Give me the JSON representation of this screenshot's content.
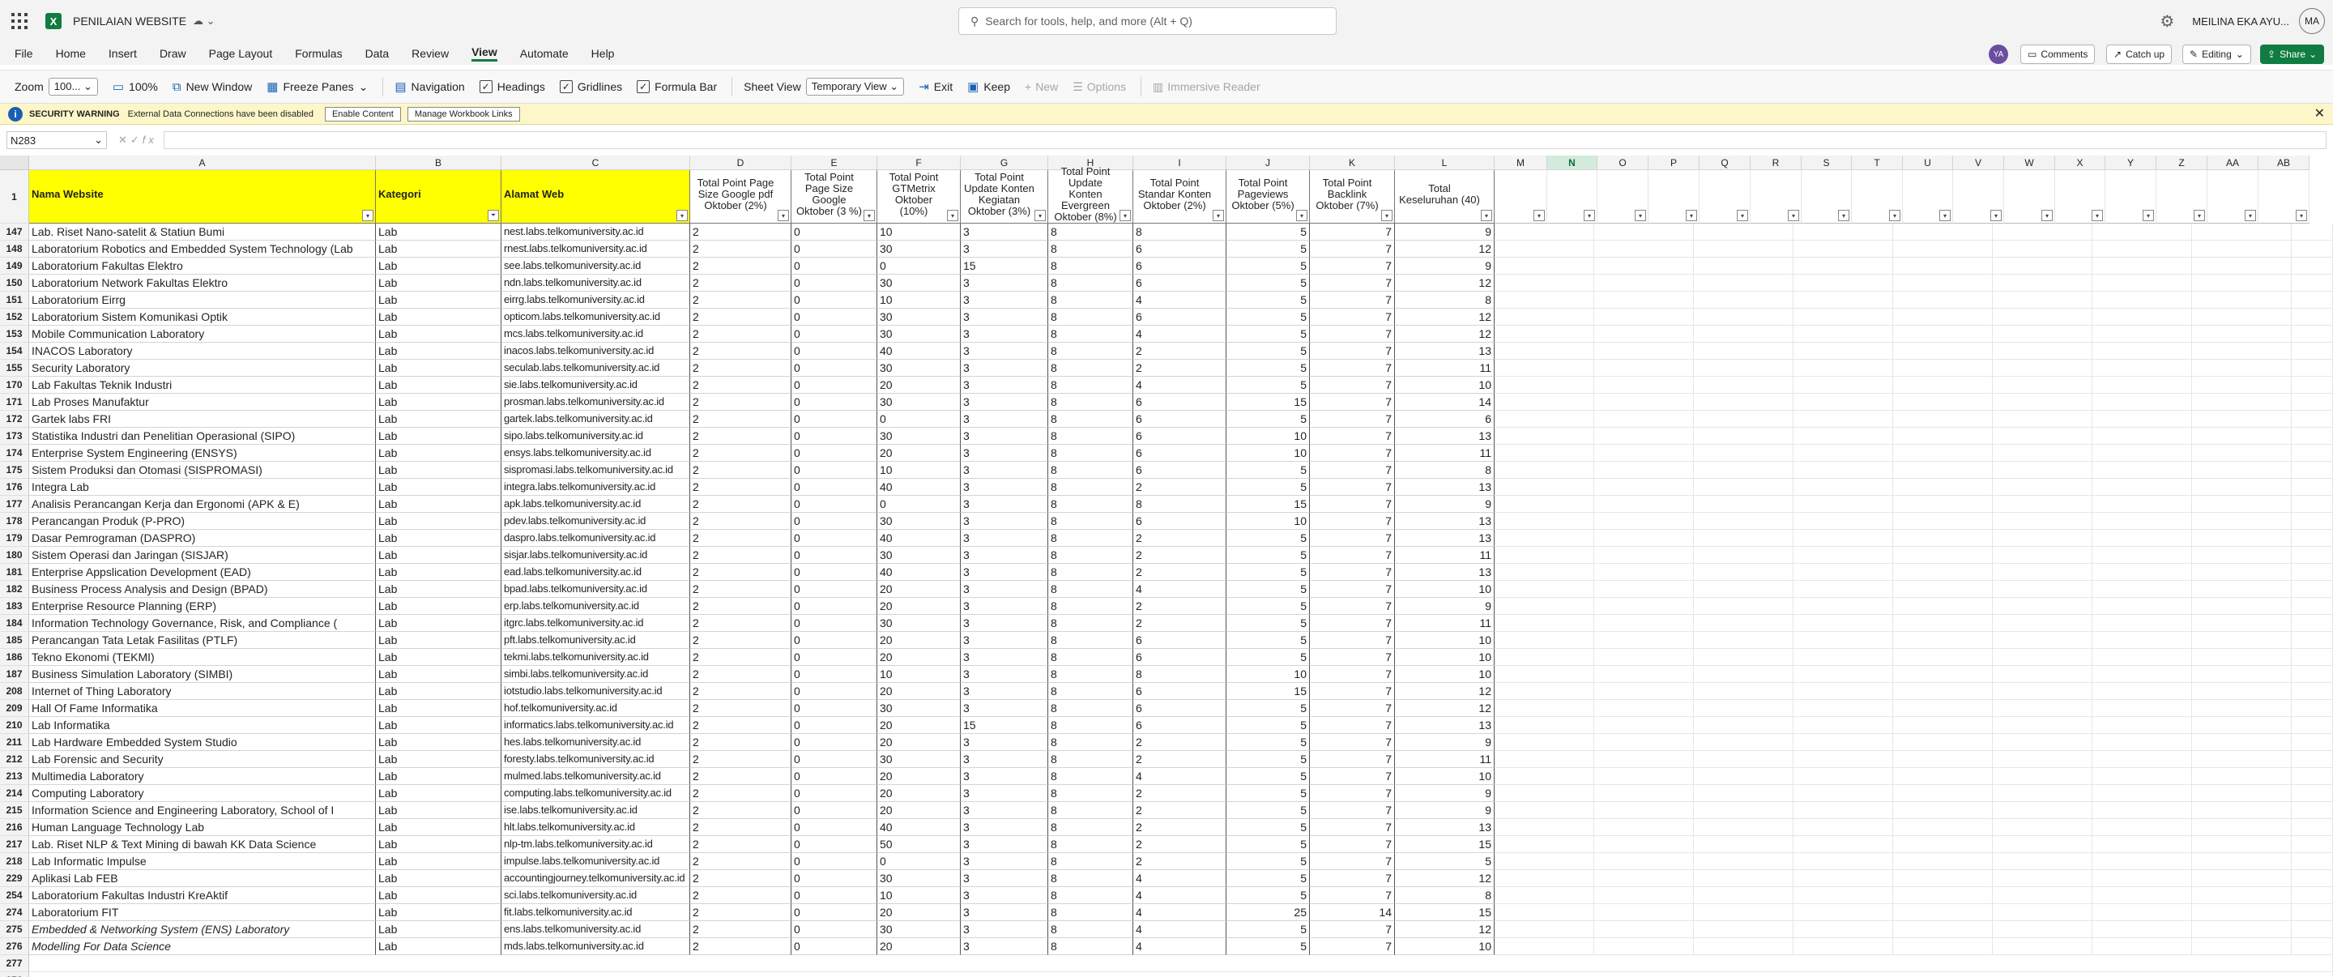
{
  "app": {
    "doc_title": "PENILAIAN WEBSITE",
    "search_placeholder": "Search for tools, help, and more (Alt + Q)",
    "user_name": "MEILINA EKA AYU...",
    "user_initials": "MA",
    "presence_initials": "YA"
  },
  "menu": {
    "items": [
      "File",
      "Home",
      "Insert",
      "Draw",
      "Page Layout",
      "Formulas",
      "Data",
      "Review",
      "View",
      "Automate",
      "Help"
    ],
    "active": "View",
    "comments": "Comments",
    "catchup": "Catch up",
    "editing": "Editing",
    "share": "Share"
  },
  "ribbon": {
    "zoom_label": "Zoom",
    "zoom_value": "100...",
    "zoom_100": "100%",
    "new_window": "New Window",
    "freeze": "Freeze Panes",
    "navigation": "Navigation",
    "headings": "Headings",
    "gridlines": "Gridlines",
    "formula_bar": "Formula Bar",
    "sheet_view": "Sheet View",
    "temp_view": "Temporary View",
    "exit": "Exit",
    "keep": "Keep",
    "new": "New",
    "options": "Options",
    "immersive": "Immersive Reader"
  },
  "security": {
    "title": "SECURITY WARNING",
    "message": "External Data Connections have been disabled",
    "enable": "Enable Content",
    "manage": "Manage Workbook Links"
  },
  "formula": {
    "name_box": "N283",
    "fx": "fx",
    "value": ""
  },
  "sheet": {
    "columns": [
      "A",
      "B",
      "C",
      "D",
      "E",
      "F",
      "G",
      "H",
      "I",
      "J",
      "K",
      "L",
      "M",
      "N",
      "O",
      "P",
      "Q",
      "R",
      "S",
      "T",
      "U",
      "V",
      "W",
      "X",
      "Y",
      "Z",
      "AA",
      "AB"
    ],
    "selected_column": "N",
    "header_row_number": "1",
    "headers": [
      "Nama Website",
      "Kategori",
      "Alamat Web",
      "Total Point Page Size Google pdf Oktober (2%)",
      "Total Point Page Size Google Oktober (3 %)",
      "Total Point GTMetrix Oktober (10%)",
      "Total Point Update Konten Kegiatan Oktober (3%)",
      "Total Point Update Konten Evergreen Oktober (8%)",
      "Total Point Standar Konten Oktober (2%)",
      "Total Point Pageviews Oktober (5%)",
      "Total Point Backlink Oktober (7%)",
      "Total Keseluruhan (40)"
    ],
    "rows": [
      {
        "n": "147",
        "a": "Lab. Riset Nano-satelit & Statiun Bumi",
        "b": "Lab",
        "c": "nest.labs.telkomuniversity.ac.id",
        "d": "2",
        "e": "0",
        "f": "10",
        "g": "3",
        "h": "8",
        "i": "8",
        "j": "5",
        "k": "7",
        "l": "9"
      },
      {
        "n": "148",
        "a": "Laboratorium Robotics and Embedded System Technology (Lab",
        "b": "Lab",
        "c": "rnest.labs.telkomuniversity.ac.id",
        "d": "2",
        "e": "0",
        "f": "30",
        "g": "3",
        "h": "8",
        "i": "6",
        "j": "5",
        "k": "7",
        "l": "12"
      },
      {
        "n": "149",
        "a": "Laboratorium Fakultas Elektro",
        "b": "Lab",
        "c": "see.labs.telkomuniversity.ac.id",
        "d": "2",
        "e": "0",
        "f": "0",
        "g": "15",
        "h": "8",
        "i": "6",
        "j": "5",
        "k": "7",
        "l": "9"
      },
      {
        "n": "150",
        "a": "Laboratorium Network Fakultas Elektro",
        "b": "Lab",
        "c": "ndn.labs.telkomuniversity.ac.id",
        "d": "2",
        "e": "0",
        "f": "30",
        "g": "3",
        "h": "8",
        "i": "6",
        "j": "5",
        "k": "7",
        "l": "12"
      },
      {
        "n": "151",
        "a": "Laboratorium Eirrg",
        "b": "Lab",
        "c": "eirrg.labs.telkomuniversity.ac.id",
        "d": "2",
        "e": "0",
        "f": "10",
        "g": "3",
        "h": "8",
        "i": "4",
        "j": "5",
        "k": "7",
        "l": "8"
      },
      {
        "n": "152",
        "a": "Laboratorium Sistem Komunikasi Optik",
        "b": "Lab",
        "c": "opticom.labs.telkomuniversity.ac.id",
        "d": "2",
        "e": "0",
        "f": "30",
        "g": "3",
        "h": "8",
        "i": "6",
        "j": "5",
        "k": "7",
        "l": "12"
      },
      {
        "n": "153",
        "a": "Mobile Communication Laboratory",
        "b": "Lab",
        "c": "mcs.labs.telkomuniversity.ac.id",
        "d": "2",
        "e": "0",
        "f": "30",
        "g": "3",
        "h": "8",
        "i": "4",
        "j": "5",
        "k": "7",
        "l": "12"
      },
      {
        "n": "154",
        "a": "INACOS Laboratory",
        "b": "Lab",
        "c": "inacos.labs.telkomuniversity.ac.id",
        "d": "2",
        "e": "0",
        "f": "40",
        "g": "3",
        "h": "8",
        "i": "2",
        "j": "5",
        "k": "7",
        "l": "13"
      },
      {
        "n": "155",
        "a": "Security Laboratory",
        "b": "Lab",
        "c": "seculab.labs.telkomuniversity.ac.id",
        "d": "2",
        "e": "0",
        "f": "30",
        "g": "3",
        "h": "8",
        "i": "2",
        "j": "5",
        "k": "7",
        "l": "11"
      },
      {
        "n": "170",
        "a": "Lab Fakultas Teknik Industri",
        "b": "Lab",
        "c": "sie.labs.telkomuniversity.ac.id",
        "d": "2",
        "e": "0",
        "f": "20",
        "g": "3",
        "h": "8",
        "i": "4",
        "j": "5",
        "k": "7",
        "l": "10"
      },
      {
        "n": "171",
        "a": "Lab Proses Manufaktur",
        "b": "Lab",
        "c": "prosman.labs.telkomuniversity.ac.id",
        "d": "2",
        "e": "0",
        "f": "30",
        "g": "3",
        "h": "8",
        "i": "6",
        "j": "15",
        "k": "7",
        "l": "14"
      },
      {
        "n": "172",
        "a": "Gartek labs FRI",
        "b": "Lab",
        "c": "gartek.labs.telkomuniversity.ac.id",
        "d": "2",
        "e": "0",
        "f": "0",
        "g": "3",
        "h": "8",
        "i": "6",
        "j": "5",
        "k": "7",
        "l": "6"
      },
      {
        "n": "173",
        "a": "Statistika Industri dan Penelitian Operasional (SIPO)",
        "b": "Lab",
        "c": "sipo.labs.telkomuniversity.ac.id",
        "d": "2",
        "e": "0",
        "f": "30",
        "g": "3",
        "h": "8",
        "i": "6",
        "j": "10",
        "k": "7",
        "l": "13"
      },
      {
        "n": "174",
        "a": "Enterprise System Engineering (ENSYS)",
        "b": "Lab",
        "c": "ensys.labs.telkomuniversity.ac.id",
        "d": "2",
        "e": "0",
        "f": "20",
        "g": "3",
        "h": "8",
        "i": "6",
        "j": "10",
        "k": "7",
        "l": "11"
      },
      {
        "n": "175",
        "a": "Sistem Produksi dan Otomasi (SISPROMASI)",
        "b": "Lab",
        "c": "sispromasi.labs.telkomuniversity.ac.id",
        "d": "2",
        "e": "0",
        "f": "10",
        "g": "3",
        "h": "8",
        "i": "6",
        "j": "5",
        "k": "7",
        "l": "8"
      },
      {
        "n": "176",
        "a": "Integra Lab",
        "b": "Lab",
        "c": "integra.labs.telkomuniversity.ac.id",
        "d": "2",
        "e": "0",
        "f": "40",
        "g": "3",
        "h": "8",
        "i": "2",
        "j": "5",
        "k": "7",
        "l": "13"
      },
      {
        "n": "177",
        "a": "Analisis Perancangan Kerja dan Ergonomi (APK & E)",
        "b": "Lab",
        "c": "apk.labs.telkomuniversity.ac.id",
        "d": "2",
        "e": "0",
        "f": "0",
        "g": "3",
        "h": "8",
        "i": "8",
        "j": "15",
        "k": "7",
        "l": "9"
      },
      {
        "n": "178",
        "a": "Perancangan Produk (P-PRO)",
        "b": "Lab",
        "c": "pdev.labs.telkomuniversity.ac.id",
        "d": "2",
        "e": "0",
        "f": "30",
        "g": "3",
        "h": "8",
        "i": "6",
        "j": "10",
        "k": "7",
        "l": "13"
      },
      {
        "n": "179",
        "a": "Dasar Pemrograman (DASPRO)",
        "b": "Lab",
        "c": "daspro.labs.telkomuniversity.ac.id",
        "d": "2",
        "e": "0",
        "f": "40",
        "g": "3",
        "h": "8",
        "i": "2",
        "j": "5",
        "k": "7",
        "l": "13"
      },
      {
        "n": "180",
        "a": "Sistem Operasi dan Jaringan (SISJAR)",
        "b": "Lab",
        "c": "sisjar.labs.telkomuniversity.ac.id",
        "d": "2",
        "e": "0",
        "f": "30",
        "g": "3",
        "h": "8",
        "i": "2",
        "j": "5",
        "k": "7",
        "l": "11"
      },
      {
        "n": "181",
        "a": "Enterprise Appslication Development (EAD)",
        "b": "Lab",
        "c": "ead.labs.telkomuniversity.ac.id",
        "d": "2",
        "e": "0",
        "f": "40",
        "g": "3",
        "h": "8",
        "i": "2",
        "j": "5",
        "k": "7",
        "l": "13"
      },
      {
        "n": "182",
        "a": "Business Process Analysis and Design (BPAD)",
        "b": "Lab",
        "c": "bpad.labs.telkomuniversity.ac.id",
        "d": "2",
        "e": "0",
        "f": "20",
        "g": "3",
        "h": "8",
        "i": "4",
        "j": "5",
        "k": "7",
        "l": "10"
      },
      {
        "n": "183",
        "a": "Enterprise Resource Planning (ERP)",
        "b": "Lab",
        "c": "erp.labs.telkomuniversity.ac.id",
        "d": "2",
        "e": "0",
        "f": "20",
        "g": "3",
        "h": "8",
        "i": "2",
        "j": "5",
        "k": "7",
        "l": "9"
      },
      {
        "n": "184",
        "a": "Information Technology Governance, Risk, and Compliance (",
        "b": "Lab",
        "c": "itgrc.labs.telkomuniversity.ac.id",
        "d": "2",
        "e": "0",
        "f": "30",
        "g": "3",
        "h": "8",
        "i": "2",
        "j": "5",
        "k": "7",
        "l": "11"
      },
      {
        "n": "185",
        "a": "Perancangan Tata Letak Fasilitas (PTLF)",
        "b": "Lab",
        "c": "pft.labs.telkomuniversity.ac.id",
        "d": "2",
        "e": "0",
        "f": "20",
        "g": "3",
        "h": "8",
        "i": "6",
        "j": "5",
        "k": "7",
        "l": "10"
      },
      {
        "n": "186",
        "a": "Tekno Ekonomi (TEKMI)",
        "b": "Lab",
        "c": "tekmi.labs.telkomuniversity.ac.id",
        "d": "2",
        "e": "0",
        "f": "20",
        "g": "3",
        "h": "8",
        "i": "6",
        "j": "5",
        "k": "7",
        "l": "10"
      },
      {
        "n": "187",
        "a": "Business Simulation Laboratory (SIMBI)",
        "b": "Lab",
        "c": "simbi.labs.telkomuniversity.ac.id",
        "d": "2",
        "e": "0",
        "f": "10",
        "g": "3",
        "h": "8",
        "i": "8",
        "j": "10",
        "k": "7",
        "l": "10"
      },
      {
        "n": "208",
        "a": "Internet of Thing Laboratory",
        "b": "Lab",
        "c": "iotstudio.labs.telkomuniversity.ac.id",
        "d": "2",
        "e": "0",
        "f": "20",
        "g": "3",
        "h": "8",
        "i": "6",
        "j": "15",
        "k": "7",
        "l": "12"
      },
      {
        "n": "209",
        "a": "Hall Of Fame Informatika",
        "b": "Lab",
        "c": "hof.telkomuniversity.ac.id",
        "d": "2",
        "e": "0",
        "f": "30",
        "g": "3",
        "h": "8",
        "i": "6",
        "j": "5",
        "k": "7",
        "l": "12"
      },
      {
        "n": "210",
        "a": "Lab Informatika",
        "b": "Lab",
        "c": "informatics.labs.telkomuniversity.ac.id",
        "d": "2",
        "e": "0",
        "f": "20",
        "g": "15",
        "h": "8",
        "i": "6",
        "j": "5",
        "k": "7",
        "l": "13"
      },
      {
        "n": "211",
        "a": "Lab Hardware Embedded System Studio",
        "b": "Lab",
        "c": "hes.labs.telkomuniversity.ac.id",
        "d": "2",
        "e": "0",
        "f": "20",
        "g": "3",
        "h": "8",
        "i": "2",
        "j": "5",
        "k": "7",
        "l": "9"
      },
      {
        "n": "212",
        "a": "Lab Forensic and Security",
        "b": "Lab",
        "c": "foresty.labs.telkomuniversity.ac.id",
        "d": "2",
        "e": "0",
        "f": "30",
        "g": "3",
        "h": "8",
        "i": "2",
        "j": "5",
        "k": "7",
        "l": "11"
      },
      {
        "n": "213",
        "a": "Multimedia Laboratory",
        "b": "Lab",
        "c": "mulmed.labs.telkomuniversity.ac.id",
        "d": "2",
        "e": "0",
        "f": "20",
        "g": "3",
        "h": "8",
        "i": "4",
        "j": "5",
        "k": "7",
        "l": "10"
      },
      {
        "n": "214",
        "a": "Computing Laboratory",
        "b": "Lab",
        "c": "computing.labs.telkomuniversity.ac.id",
        "d": "2",
        "e": "0",
        "f": "20",
        "g": "3",
        "h": "8",
        "i": "2",
        "j": "5",
        "k": "7",
        "l": "9"
      },
      {
        "n": "215",
        "a": "Information Science and Engineering Laboratory, School of I",
        "b": "Lab",
        "c": "ise.labs.telkomuniversity.ac.id",
        "d": "2",
        "e": "0",
        "f": "20",
        "g": "3",
        "h": "8",
        "i": "2",
        "j": "5",
        "k": "7",
        "l": "9"
      },
      {
        "n": "216",
        "a": "Human Language Technology Lab",
        "b": "Lab",
        "c": "hlt.labs.telkomuniversity.ac.id",
        "d": "2",
        "e": "0",
        "f": "40",
        "g": "3",
        "h": "8",
        "i": "2",
        "j": "5",
        "k": "7",
        "l": "13"
      },
      {
        "n": "217",
        "a": "Lab. Riset NLP & Text Mining di bawah KK Data Science",
        "b": "Lab",
        "c": "nlp-tm.labs.telkomuniversity.ac.id",
        "d": "2",
        "e": "0",
        "f": "50",
        "g": "3",
        "h": "8",
        "i": "2",
        "j": "5",
        "k": "7",
        "l": "15"
      },
      {
        "n": "218",
        "a": "Lab Informatic Impulse",
        "b": "Lab",
        "c": "impulse.labs.telkomuniversity.ac.id",
        "d": "2",
        "e": "0",
        "f": "0",
        "g": "3",
        "h": "8",
        "i": "2",
        "j": "5",
        "k": "7",
        "l": "5"
      },
      {
        "n": "229",
        "a": "Aplikasi Lab FEB",
        "b": "Lab",
        "c": "accountingjourney.telkomuniversity.ac.id",
        "d": "2",
        "e": "0",
        "f": "30",
        "g": "3",
        "h": "8",
        "i": "4",
        "j": "5",
        "k": "7",
        "l": "12"
      },
      {
        "n": "254",
        "a": "Laboratorium Fakultas Industri KreAktif",
        "b": "Lab",
        "c": "sci.labs.telkomuniversity.ac.id",
        "d": "2",
        "e": "0",
        "f": "10",
        "g": "3",
        "h": "8",
        "i": "4",
        "j": "5",
        "k": "7",
        "l": "8"
      },
      {
        "n": "274",
        "a": "Laboratorium FIT",
        "b": "Lab",
        "c": "fit.labs.telkomuniversity.ac.id",
        "d": "2",
        "e": "0",
        "f": "20",
        "g": "3",
        "h": "8",
        "i": "4",
        "j": "25",
        "k": "14",
        "l": "15"
      },
      {
        "n": "275",
        "a": "Embedded & Networking System (ENS) Laboratory",
        "b": "Lab",
        "c": "ens.labs.telkomuniversity.ac.id",
        "d": "2",
        "e": "0",
        "f": "30",
        "g": "3",
        "h": "8",
        "i": "4",
        "j": "5",
        "k": "7",
        "l": "12",
        "italic": true
      },
      {
        "n": "276",
        "a": "Modelling For Data Science",
        "b": "Lab",
        "c": "mds.labs.telkomuniversity.ac.id",
        "d": "2",
        "e": "0",
        "f": "20",
        "g": "3",
        "h": "8",
        "i": "4",
        "j": "5",
        "k": "7",
        "l": "10",
        "italic": true
      }
    ],
    "trailing_rows": [
      "277",
      "278"
    ]
  },
  "colors": {
    "header_fill": "#ffff00",
    "accent": "#107c41",
    "warning_bg": "#fdf6c8"
  }
}
